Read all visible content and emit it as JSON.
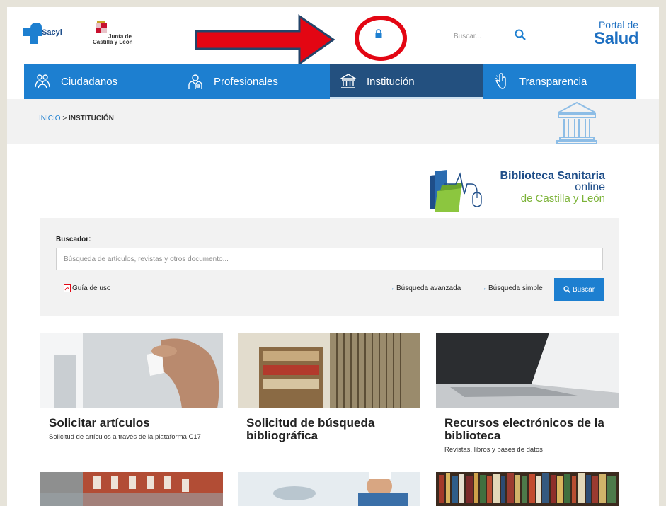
{
  "header": {
    "sacyl_label": "Sacyl",
    "jcyl_line1": "Junta de",
    "jcyl_line2": "Castilla y León",
    "search_placeholder": "Buscar...",
    "portal_line1": "Portal de",
    "portal_line2": "Salud"
  },
  "nav": {
    "items": [
      {
        "label": "Ciudadanos",
        "icon": "people-icon"
      },
      {
        "label": "Profesionales",
        "icon": "doctor-icon"
      },
      {
        "label": "Institución",
        "icon": "building-icon",
        "active": true
      },
      {
        "label": "Transparencia",
        "icon": "hand-icon"
      }
    ]
  },
  "breadcrumb": {
    "home": "INICIO",
    "separator": ">",
    "current": "INSTITUCIÓN"
  },
  "biblioteca": {
    "title": "Biblioteca Sanitaria",
    "online": "online",
    "region": "de Castilla y León"
  },
  "search": {
    "label": "Buscador:",
    "placeholder": "Búsqueda de artículos, revistas y otros documento...",
    "guide": "Guía de uso",
    "advanced": "Búsqueda avanzada",
    "simple": "Búsqueda simple",
    "button": "Buscar"
  },
  "cards": [
    {
      "title": "Solicitar artículos",
      "description": "Solicitud de artículos a través de la plataforma C17"
    },
    {
      "title": "Solicitud de búsqueda bibliográfica",
      "description": ""
    },
    {
      "title": "Recursos electrónicos de la biblioteca",
      "description": "Revistas, libros y bases de datos"
    }
  ],
  "colors": {
    "brand_blue": "#1d7fd0",
    "nav_active": "#23507f",
    "annotation_red": "#e30613"
  }
}
